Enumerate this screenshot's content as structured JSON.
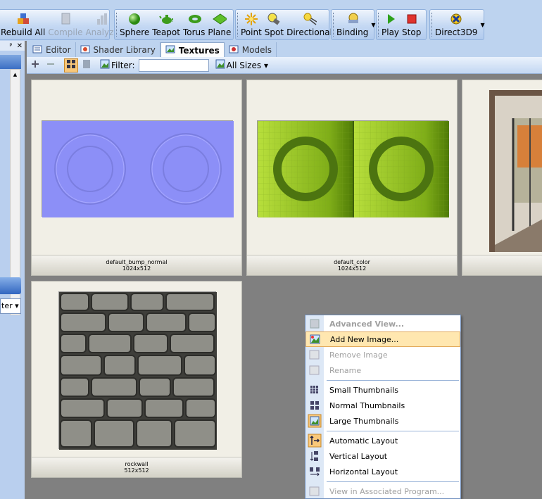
{
  "toolbar": {
    "group1": [
      {
        "label": "Rebuild All",
        "icon": "rebuild-icon",
        "enabled": true
      },
      {
        "label": "Compile",
        "icon": "compile-icon",
        "enabled": false
      },
      {
        "label": "Analyze",
        "icon": "analyze-icon",
        "enabled": false
      }
    ],
    "group2": [
      {
        "label": "Sphere",
        "icon": "sphere-icon"
      },
      {
        "label": "Teapot",
        "icon": "teapot-icon"
      },
      {
        "label": "Torus",
        "icon": "torus-icon"
      },
      {
        "label": "Plane",
        "icon": "plane-icon"
      }
    ],
    "group3": [
      {
        "label": "Point",
        "icon": "point-light-icon"
      },
      {
        "label": "Spot",
        "icon": "spot-light-icon"
      },
      {
        "label": "Directional",
        "icon": "directional-light-icon"
      }
    ],
    "binding": {
      "label": "Binding",
      "icon": "binding-icon"
    },
    "group5": [
      {
        "label": "Play",
        "icon": "play-icon"
      },
      {
        "label": "Stop",
        "icon": "stop-icon"
      }
    ],
    "renderer": {
      "label": "Direct3D9",
      "icon": "direct3d-icon"
    }
  },
  "left_panel": {
    "pin": "ᵖ",
    "close": "✕",
    "combo_text": "ter ▾"
  },
  "tabs": [
    {
      "label": "Editor",
      "active": false
    },
    {
      "label": "Shader Library",
      "active": false
    },
    {
      "label": "Textures",
      "active": true
    },
    {
      "label": "Models",
      "active": false
    }
  ],
  "subbar": {
    "filter_label": "Filter:",
    "filter_value": "",
    "size_label": "All Sizes ▾"
  },
  "textures": [
    {
      "name": "default_bump_normal",
      "size": "1024x512"
    },
    {
      "name": "default_color",
      "size": "1024x512"
    },
    {
      "name": "",
      "size": ""
    },
    {
      "name": "rockwall",
      "size": "512x512"
    }
  ],
  "context_menu": [
    {
      "label": "Advanced View...",
      "icon": "advanced-view-icon",
      "state": "disabled-bold"
    },
    {
      "label": "Add New Image...",
      "icon": "add-image-icon",
      "state": "highlighted"
    },
    {
      "label": "Remove Image",
      "icon": "remove-image-icon",
      "state": "disabled"
    },
    {
      "label": "Rename",
      "icon": "rename-icon",
      "state": "disabled"
    },
    {
      "label": "Small Thumbnails",
      "icon": "small-thumbnails-icon",
      "state": "normal"
    },
    {
      "label": "Normal Thumbnails",
      "icon": "normal-thumbnails-icon",
      "state": "normal"
    },
    {
      "label": "Large Thumbnails",
      "icon": "large-thumbnails-icon",
      "state": "checked"
    },
    {
      "label": "Automatic Layout",
      "icon": "automatic-layout-icon",
      "state": "checked"
    },
    {
      "label": "Vertical Layout",
      "icon": "vertical-layout-icon",
      "state": "normal"
    },
    {
      "label": "Horizontal Layout",
      "icon": "horizontal-layout-icon",
      "state": "normal"
    },
    {
      "label": "View in Associated Program...",
      "icon": "view-program-icon",
      "state": "disabled"
    }
  ]
}
